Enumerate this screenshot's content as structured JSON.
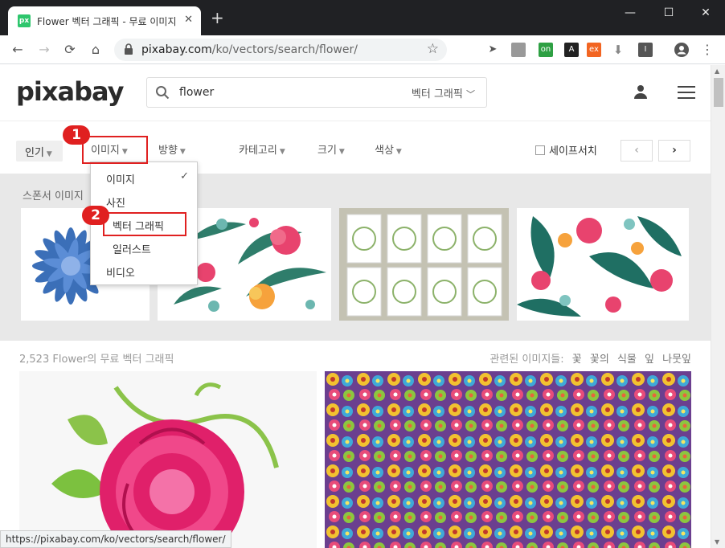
{
  "browser": {
    "tab_title": "Flower 벡터 그래픽 - 무료 이미지",
    "tab_favicon": "px",
    "new_tab": "+",
    "url_host": "pixabay.com",
    "url_path": "/ko/vectors/search/flower/",
    "status_url": "https://pixabay.com/ko/vectors/search/flower/",
    "extensions": [
      {
        "icon": "cursor-extension-icon",
        "label": ""
      },
      {
        "icon": "folder-extension-icon",
        "label": ""
      },
      {
        "icon": "on-extension-icon",
        "label": "on"
      },
      {
        "icon": "a-extension-icon",
        "label": "A"
      },
      {
        "icon": "ex-extension-icon",
        "label": "ex"
      },
      {
        "icon": "download-extension-icon",
        "label": ""
      },
      {
        "icon": "i-extension-icon",
        "label": "I"
      }
    ]
  },
  "site": {
    "logo": "pixabay",
    "search_value": "flower",
    "search_type": "벡터 그래픽"
  },
  "filters": {
    "popular": "인기",
    "images": "이미지",
    "orientation": "방향",
    "category": "카테고리",
    "size": "크기",
    "color": "색상",
    "safe_search": "세이프서치",
    "prev": "‹",
    "next": "›"
  },
  "dropdown": {
    "items": [
      "이미지",
      "사진",
      "벡터 그래픽",
      "일러스트",
      "비디오"
    ],
    "checked": "✓"
  },
  "annotations": {
    "badge1": "1",
    "badge2": "2"
  },
  "sponsor": {
    "label": "스폰서 이미지"
  },
  "results": {
    "label": "2,523 Flower의 무료 벡터 그래픽",
    "related_label": "관련된 이미지들:",
    "related": [
      "꽃",
      "꽃의",
      "식물",
      "잎",
      "나뭇잎"
    ]
  }
}
